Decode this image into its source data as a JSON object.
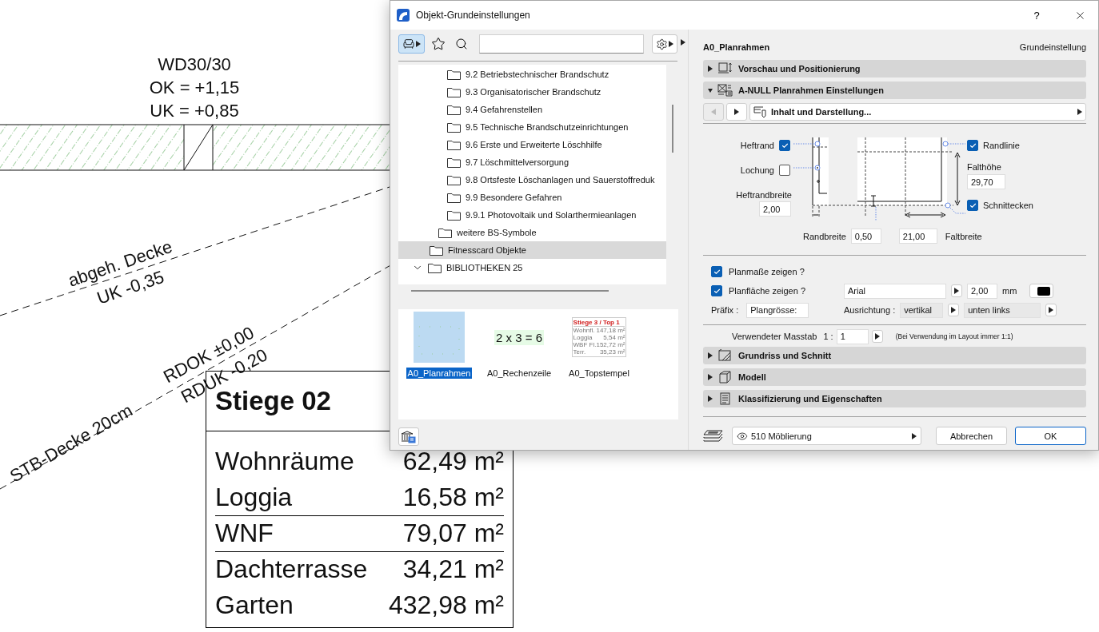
{
  "canvas": {
    "wall_label": [
      "WD30/30",
      "OK = +1,15",
      "UK = +0,85"
    ],
    "annotations": [
      "abgeh. Decke",
      "UK -0,35",
      "RDOK ±0,00",
      "RDUK -0,20",
      "STB-Decke 20cm"
    ],
    "room_stamp": {
      "title": "Stiege 02",
      "rows": [
        {
          "name": "Wohnräume",
          "value": "62,49 m²",
          "rule_below": false
        },
        {
          "name": "Loggia",
          "value": "16,58 m²",
          "rule_below": true
        },
        {
          "name": "WNF",
          "value": "79,07 m²",
          "rule_below": true
        },
        {
          "name": "Dachterrasse",
          "value": "34,21 m²",
          "rule_below": false
        },
        {
          "name": "Garten",
          "value": "432,98 m²",
          "rule_below": false
        }
      ]
    }
  },
  "dialog": {
    "title": "Objekt-Grundeinstellungen",
    "help": "?",
    "library": {
      "tree": [
        {
          "children": [
            {
              "children": [
                {
                  "label": "9.2 Betriebstechnischer Brandschutz",
                  "selected": false
                },
                {
                  "label": "9.3 Organisatorischer Brandschutz",
                  "selected": false
                },
                {
                  "label": "9.4 Gefahrenstellen",
                  "selected": false
                },
                {
                  "label": "9.5 Technische Brandschutzeinrichtungen",
                  "selected": false
                },
                {
                  "label": "9.6 Erste und Erweiterte Löschhilfe",
                  "selected": false
                },
                {
                  "label": "9.7 Löschmittelversorgung",
                  "selected": false
                },
                {
                  "label": "9.8 Ortsfeste Löschanlagen und Sauerstoffreduk",
                  "selected": false
                },
                {
                  "label": "9.9 Besondere Gefahren",
                  "selected": false
                },
                {
                  "label": "9.9.1 Photovoltaik und Solarthermieanlagen",
                  "selected": false
                }
              ]
            },
            {
              "label": "weitere BS-Symbole",
              "selected": false
            }
          ]
        },
        {
          "label": "Fitnesscard Objekte",
          "selected": true
        },
        {
          "label": "BIBLIOTHEKEN 25",
          "selected": false,
          "expanded": true
        }
      ],
      "thumbnails": [
        {
          "kind": "frame",
          "label": "A0_Planrahmen",
          "selected": true
        },
        {
          "kind": "formula",
          "label": "A0_Rechenzeile",
          "selected": false,
          "formula": "2 x 3 = 6"
        },
        {
          "kind": "stamp",
          "label": "A0_Topstempel",
          "selected": false,
          "stamp_title": "Stiege 3  / Top 1",
          "stamp_rows": [
            {
              "name": "Wohnfl.",
              "value": "147,18 m²"
            },
            {
              "name": "Loggia",
              "value": "5,54 m²"
            },
            {
              "name": "WBF Fl.",
              "value": "152,72 m²"
            },
            {
              "name": "Terr.",
              "value": "35,23 m²"
            }
          ]
        }
      ]
    },
    "settings": {
      "object_name": "A0_Planrahmen",
      "preset": "Grundeinstellung",
      "sections": [
        {
          "kind": "preview",
          "title": "Vorschau und Positionierung",
          "expanded": false
        },
        {
          "kind": "parameters",
          "title": "A-NULL Planrahmen Einstellungen",
          "expanded": true
        },
        {
          "kind": "plan",
          "title": "Grundriss und Schnitt",
          "expanded": false
        },
        {
          "kind": "model",
          "title": "Modell",
          "expanded": false
        },
        {
          "kind": "classification",
          "title": "Klassifizierung und Eigenschaften",
          "expanded": false
        }
      ],
      "parameters": {
        "page": "Inhalt und Darstellung...",
        "prev_disabled": true,
        "frame": {
          "binding_edge": {
            "label": "Heftrand",
            "checked": true
          },
          "punching": {
            "label": "Lochung",
            "checked": false
          },
          "binding_width": {
            "label": "Heftrandbreite",
            "value": "2,00"
          },
          "border_line": {
            "label": "Randlinie",
            "checked": true
          },
          "fold_height": {
            "label": "Falthöhe",
            "value": "29,70"
          },
          "crop_marks": {
            "label": "Schnittecken",
            "checked": true
          },
          "margin_width": {
            "label": "Randbreite",
            "value": "0,50"
          },
          "fold_width": {
            "label": "Faltbreite",
            "value": "21,00"
          }
        },
        "options": [
          {
            "label": "Planmaße zeigen ?",
            "checked": true
          },
          {
            "label": "Planfläche zeigen ?",
            "checked": true
          }
        ],
        "font": {
          "name": "Arial",
          "size": "2,00",
          "unit": "mm"
        },
        "prefix": {
          "label": "Präfix :",
          "value": "Plangrösse:"
        },
        "alignment": {
          "label": "Ausrichtung :",
          "values": [
            "vertikal",
            "unten links"
          ]
        },
        "scale": {
          "label": "Verwendeter Masstab",
          "ratio": "1 :",
          "value": "1",
          "note": "(Bei Verwendung im Layout immer 1:1)"
        }
      }
    },
    "footer": {
      "layer": "510 Möblierung",
      "buttons": [
        {
          "label": "Abbrechen",
          "default": false
        },
        {
          "label": "OK",
          "default": true
        }
      ]
    }
  }
}
